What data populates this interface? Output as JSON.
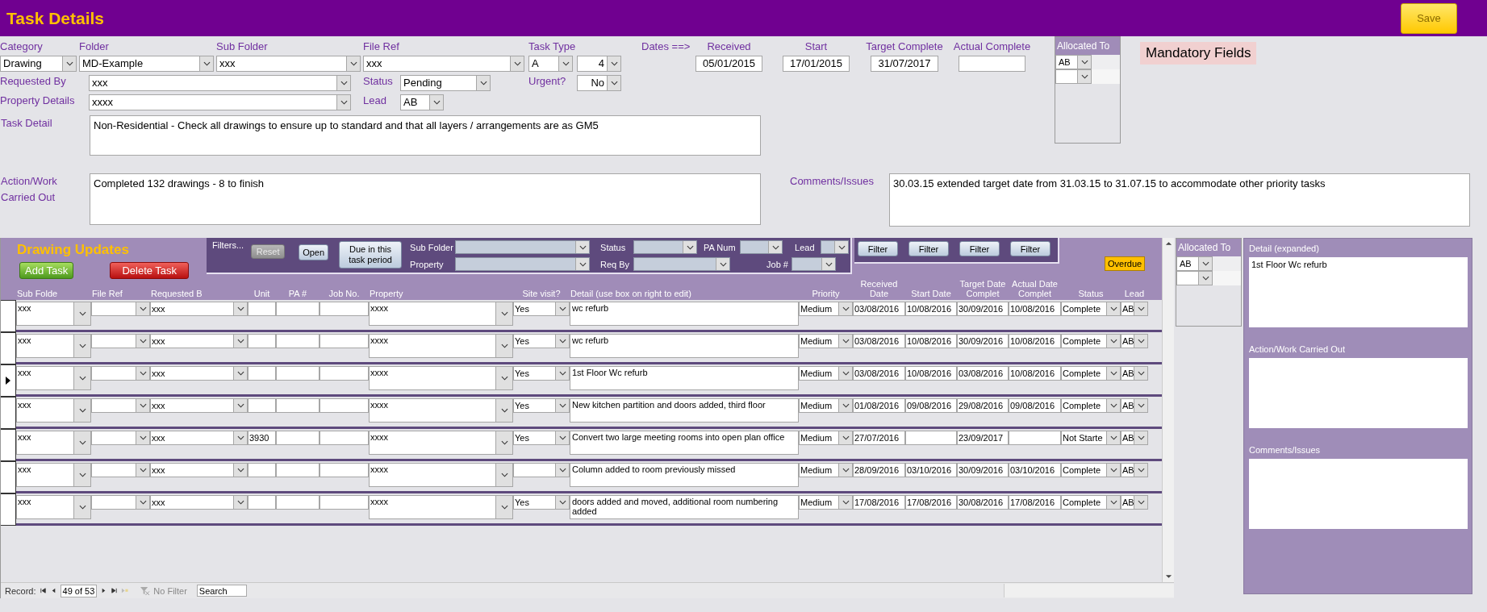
{
  "title": "Task Details",
  "save_button": "Save",
  "form": {
    "category": {
      "label": "Category",
      "value": "Drawing"
    },
    "folder": {
      "label": "Folder",
      "value": "MD-Example"
    },
    "sub_folder": {
      "label": "Sub Folder",
      "value": "xxx"
    },
    "file_ref": {
      "label": "File Ref",
      "value": "xxx"
    },
    "task_type": {
      "label": "Task Type",
      "values": [
        "A",
        "4"
      ]
    },
    "dates_label": "Dates ==>",
    "received": {
      "label": "Received",
      "value": "05/01/2015"
    },
    "start": {
      "label": "Start",
      "value": "17/01/2015"
    },
    "target_complete": {
      "label": "Target Complete",
      "value": "31/07/2017"
    },
    "actual_complete": {
      "label": "Actual Complete"
    },
    "requested_by": {
      "label": "Requested By",
      "value": "xxx"
    },
    "status": {
      "label": "Status",
      "value": "Pending"
    },
    "urgent": {
      "label": "Urgent?",
      "value": "No"
    },
    "property_details": {
      "label": "Property Details",
      "value": "xxxx"
    },
    "lead": {
      "label": "Lead",
      "value": "AB"
    },
    "task_detail": {
      "label": "Task Detail",
      "value": "Non-Residential - Check all drawings to ensure up to standard and that all layers / arrangements are as GM5"
    },
    "action_work": {
      "label": "Action/Work Carried Out",
      "value": "Completed 132 drawings - 8 to finish"
    },
    "comments": {
      "label": "Comments/Issues",
      "value": "30.03.15 extended target date from 31.03.15 to 31.07.15 to accommodate other priority tasks"
    }
  },
  "allocated_to": {
    "label": "Allocated To",
    "rows": [
      {
        "value": "AB"
      },
      {}
    ]
  },
  "mandatory_note": "Mandatory Fields",
  "drawing_updates": {
    "title": "Drawing Updates",
    "add_button": "Add Task",
    "delete_button": "Delete Task",
    "filters": {
      "label": "Filters...",
      "reset": {
        "label": "Reset",
        "disabled": true
      },
      "open": "Open",
      "due": "Due in this task period",
      "sub_folder": "Sub Folder",
      "property": "Property",
      "status": "Status",
      "req_by": "Req By",
      "pa_num": "PA Num",
      "job": "Job #",
      "lead": "Lead",
      "filter_buttons": [
        "Filter",
        "Filter",
        "Filter",
        "Filter"
      ]
    },
    "overdue": "Overdue",
    "column_headers": [
      "Sub Folde",
      "File Ref",
      "Requested B",
      "Unit",
      "PA #",
      "Job No.",
      "Property",
      "Site visit?",
      "Detail (use box on right to edit)",
      "Priority",
      "Received Date",
      "Start Date",
      "Target Date Complet",
      "Actual Date Complet",
      "Status",
      "Lead"
    ],
    "rows": [
      {
        "selected": false,
        "sub_folder": "xxx",
        "requested_by": "xxx",
        "property": "xxxx",
        "site_visit": "Yes",
        "detail": "wc refurb",
        "priority": "Medium",
        "received_date": "03/08/2016",
        "start_date": "10/08/2016",
        "target_date": "30/09/2016",
        "actual_date": "10/08/2016",
        "status": "Complete",
        "lead": "AB"
      },
      {
        "selected": false,
        "sub_folder": "xxx",
        "requested_by": "xxx",
        "property": "xxxx",
        "site_visit": "Yes",
        "detail": "wc refurb",
        "priority": "Medium",
        "received_date": "03/08/2016",
        "start_date": "10/08/2016",
        "target_date": "30/09/2016",
        "actual_date": "10/08/2016",
        "status": "Complete",
        "lead": "AB"
      },
      {
        "selected": true,
        "sub_folder": "xxx",
        "requested_by": "xxx",
        "property": "xxxx",
        "site_visit": "Yes",
        "detail": "1st Floor Wc refurb",
        "priority": "Medium",
        "received_date": "03/08/2016",
        "start_date": "10/08/2016",
        "target_date": "03/08/2016",
        "actual_date": "10/08/2016",
        "status": "Complete",
        "lead": "AB"
      },
      {
        "selected": false,
        "sub_folder": "xxx",
        "requested_by": "xxx",
        "property": "xxxx",
        "site_visit": "Yes",
        "detail": "New kitchen partition and doors added, third floor",
        "priority": "Medium",
        "received_date": "01/08/2016",
        "start_date": "09/08/2016",
        "target_date": "29/08/2016",
        "actual_date": "09/08/2016",
        "status": "Complete",
        "lead": "AB"
      },
      {
        "selected": false,
        "sub_folder": "xxx",
        "requested_by": "xxx",
        "unit": "3930",
        "property": "xxxx",
        "site_visit": "Yes",
        "detail": "Convert two large meeting rooms into open plan office",
        "priority": "Medium",
        "received_date": "27/07/2016",
        "target_date": "23/09/2017",
        "status": "Not Starte",
        "lead": "AB"
      },
      {
        "selected": false,
        "sub_folder": "xxx",
        "requested_by": "xxx",
        "property": "xxxx",
        "detail": "Column added to room previously missed",
        "priority": "Medium",
        "received_date": "28/09/2016",
        "start_date": "03/10/2016",
        "target_date": "30/09/2016",
        "actual_date": "03/10/2016",
        "status": "Complete",
        "lead": "AB"
      },
      {
        "selected": false,
        "sub_folder": "xxx",
        "requested_by": "xxx",
        "property": "xxxx",
        "site_visit": "Yes",
        "detail": "doors added and moved, additional room numbering added",
        "priority": "Medium",
        "received_date": "17/08/2016",
        "start_date": "17/08/2016",
        "target_date": "30/08/2016",
        "actual_date": "17/08/2016",
        "status": "Complete",
        "lead": "AB"
      }
    ],
    "record_nav": {
      "label": "Record:",
      "position": "49 of 53",
      "filter": "No Filter",
      "search_placeholder": "Search"
    }
  },
  "allocated_to_2": {
    "label": "Allocated To",
    "rows": [
      {
        "value": "AB"
      },
      {}
    ]
  },
  "detail_panel": {
    "detail_label": "Detail (expanded)",
    "detail": "1st Floor Wc refurb",
    "action_label": "Action/Work Carried Out",
    "comments_label": "Comments/Issues"
  }
}
